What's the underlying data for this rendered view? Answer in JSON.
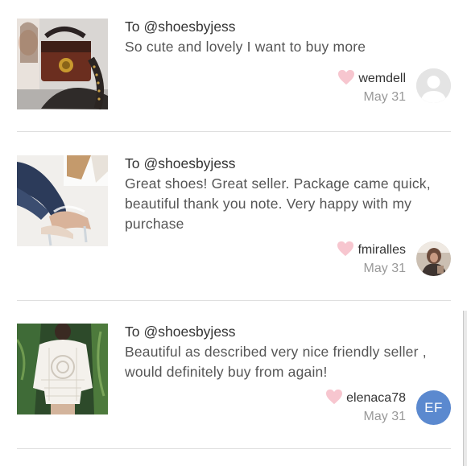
{
  "reviews": [
    {
      "to_prefix": "To",
      "to_handle": "@shoesbyjess",
      "comment": "So cute and lovely I want to buy more",
      "username": "wemdell",
      "date": "May 31",
      "avatar": "default-user-icon",
      "thumbnail": "handbag-photo"
    },
    {
      "to_prefix": "To",
      "to_handle": "@shoesbyjess",
      "comment": "Great shoes! Great seller. Package came quick, beautiful thank you note. Very happy with my purchase",
      "username": "fmiralles",
      "date": "May 31",
      "avatar": "user-photo",
      "thumbnail": "clear-heels-photo"
    },
    {
      "to_prefix": "To",
      "to_handle": "@shoesbyjess",
      "comment": "Beautiful as described very nice friendly seller , would definitely buy from again!",
      "username": "elenaca78",
      "date": "May 31",
      "avatar_initials": "EF",
      "thumbnail": "crochet-top-photo"
    }
  ],
  "colors": {
    "heart": "#f7c6cf",
    "avatar_initials_bg": "#5b89cf",
    "divider": "#dedede",
    "date": "#999999"
  }
}
